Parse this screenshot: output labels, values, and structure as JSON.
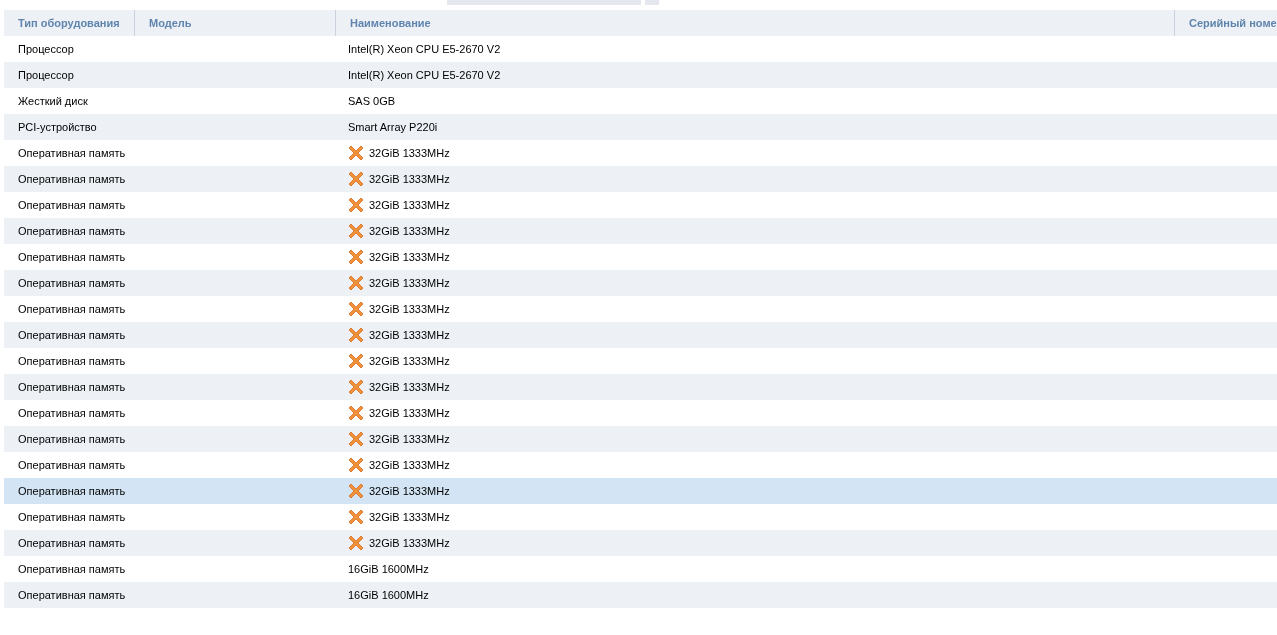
{
  "table": {
    "columns": [
      "Тип оборудования",
      "Модель",
      "Наименование",
      "Серийный номе"
    ],
    "rows": [
      {
        "type": "Процессор",
        "name": "Intel(R) Xeon CPU E5-2670 V2",
        "flagged": false,
        "selected": false
      },
      {
        "type": "Процессор",
        "name": "Intel(R) Xeon CPU E5-2670 V2",
        "flagged": false,
        "selected": false
      },
      {
        "type": "Жесткий диск",
        "name": "SAS 0GB",
        "flagged": false,
        "selected": false
      },
      {
        "type": "PCI-устройство",
        "name": "Smart Array P220i",
        "flagged": false,
        "selected": false
      },
      {
        "type": "Оперативная память",
        "name": "32GiB 1333MHz",
        "flagged": true,
        "selected": false
      },
      {
        "type": "Оперативная память",
        "name": "32GiB 1333MHz",
        "flagged": true,
        "selected": false
      },
      {
        "type": "Оперативная память",
        "name": "32GiB 1333MHz",
        "flagged": true,
        "selected": false
      },
      {
        "type": "Оперативная память",
        "name": "32GiB 1333MHz",
        "flagged": true,
        "selected": false
      },
      {
        "type": "Оперативная память",
        "name": "32GiB 1333MHz",
        "flagged": true,
        "selected": false
      },
      {
        "type": "Оперативная память",
        "name": "32GiB 1333MHz",
        "flagged": true,
        "selected": false
      },
      {
        "type": "Оперативная память",
        "name": "32GiB 1333MHz",
        "flagged": true,
        "selected": false
      },
      {
        "type": "Оперативная память",
        "name": "32GiB 1333MHz",
        "flagged": true,
        "selected": false
      },
      {
        "type": "Оперативная память",
        "name": "32GiB 1333MHz",
        "flagged": true,
        "selected": false
      },
      {
        "type": "Оперативная память",
        "name": "32GiB 1333MHz",
        "flagged": true,
        "selected": false
      },
      {
        "type": "Оперативная память",
        "name": "32GiB 1333MHz",
        "flagged": true,
        "selected": false
      },
      {
        "type": "Оперативная память",
        "name": "32GiB 1333MHz",
        "flagged": true,
        "selected": false
      },
      {
        "type": "Оперативная память",
        "name": "32GiB 1333MHz",
        "flagged": true,
        "selected": false
      },
      {
        "type": "Оперативная память",
        "name": "32GiB 1333MHz",
        "flagged": true,
        "selected": true
      },
      {
        "type": "Оперативная память",
        "name": "32GiB 1333MHz",
        "flagged": true,
        "selected": false
      },
      {
        "type": "Оперативная память",
        "name": "32GiB 1333MHz",
        "flagged": true,
        "selected": false
      },
      {
        "type": "Оперативная память",
        "name": "16GiB 1600MHz",
        "flagged": false,
        "selected": false
      },
      {
        "type": "Оперативная память",
        "name": "16GiB 1600MHz",
        "flagged": false,
        "selected": false
      }
    ]
  }
}
